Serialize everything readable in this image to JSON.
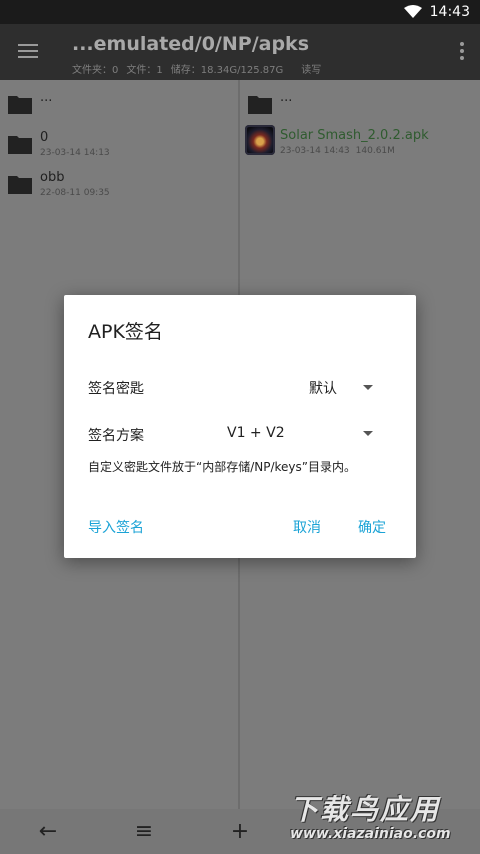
{
  "status_bar": {
    "time": "14:43"
  },
  "app_bar": {
    "title": "...emulated/0/NP/apks",
    "folders": "文件夹：0",
    "files": "文件：1",
    "storage": "储存：18.34G/125.87G",
    "mode": "读写"
  },
  "left_pane": {
    "items": [
      {
        "name": "...",
        "date": "",
        "size": ""
      },
      {
        "name": "0",
        "date": "23-03-14 14:13",
        "size": ""
      },
      {
        "name": "obb",
        "date": "22-08-11 09:35",
        "size": ""
      }
    ]
  },
  "right_pane": {
    "items": [
      {
        "name": "...",
        "date": "",
        "size": ""
      },
      {
        "name": "Solar Smash_2.0.2.apk",
        "date": "23-03-14 14:43",
        "size": "140.61M"
      }
    ]
  },
  "dialog": {
    "title": "APK签名",
    "key_label": "签名密匙",
    "key_value": "默认",
    "scheme_label": "签名方案",
    "scheme_value": "V1 + V2",
    "note": "自定义密匙文件放于“内部存储/NP/keys”目录内。",
    "import_label": "导入签名",
    "cancel_label": "取消",
    "ok_label": "确定"
  },
  "bottom_bar": {
    "back": "←",
    "list": "≡",
    "add": "+"
  },
  "watermark": {
    "top": "下载鸟应用",
    "bottom": "www.xiazainiao.com"
  },
  "colors": {
    "accent": "#1ba3d6",
    "apk_name": "#2f5b2f"
  },
  "icons": [
    "wifi-icon",
    "menu-icon",
    "overflow-icon",
    "folder-icon",
    "apk-icon",
    "back-arrow-icon",
    "list-icon",
    "add-icon",
    "dropdown-arrow-icon"
  ]
}
